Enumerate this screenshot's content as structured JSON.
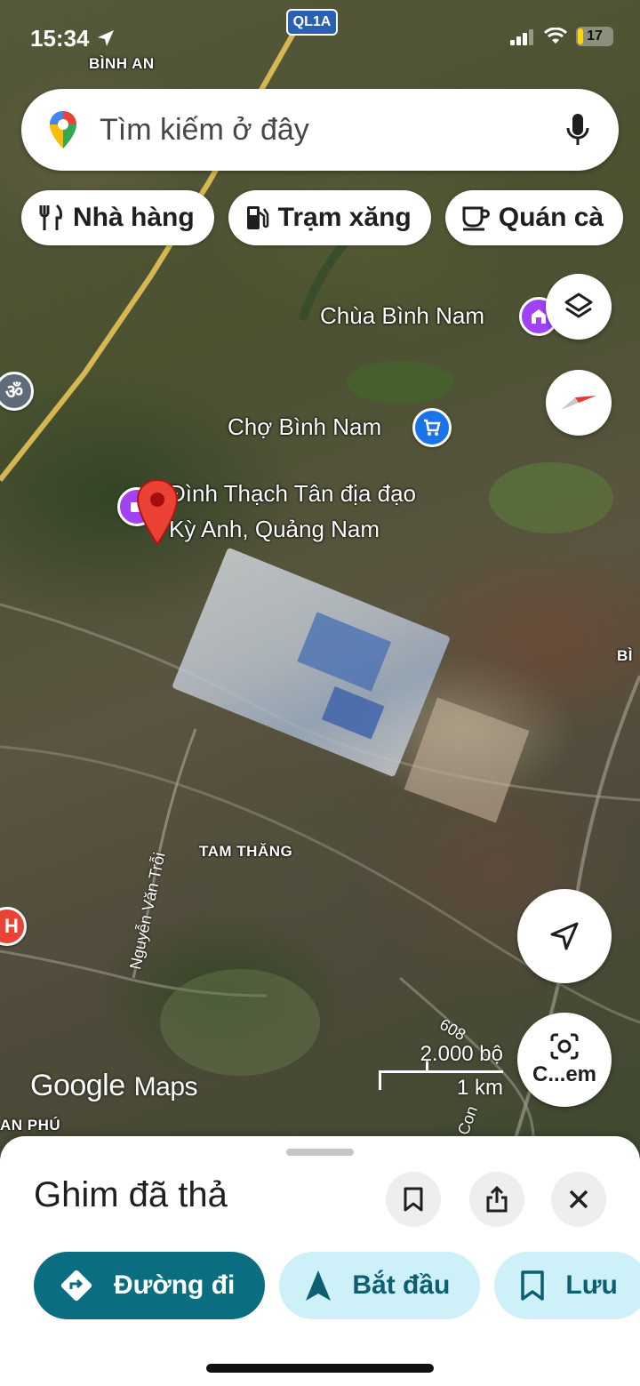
{
  "status_bar": {
    "time": "15:34",
    "battery": "17",
    "battery_level": 0.17
  },
  "highway_badge": "QL1A",
  "search": {
    "placeholder": "Tìm kiếm ở đây",
    "logo_icon": "google-maps-pin-icon",
    "mic_icon": "mic-icon"
  },
  "chips": [
    {
      "label": "Nhà hàng",
      "icon": "utensils-icon"
    },
    {
      "label": "Trạm xăng",
      "icon": "gas-station-icon"
    },
    {
      "label": "Quán cà",
      "icon": "coffee-icon"
    }
  ],
  "map": {
    "labels": {
      "binh_an": "BÌNH AN",
      "chua_binh_nam": "Chùa Bình Nam",
      "cho_binh_nam": "Chợ Bình Nam",
      "pin_line1": "Đình Thạch Tân địa đạo",
      "pin_line2": "Kỳ Anh, Quảng Nam",
      "tam_thang": "TAM THĂNG",
      "nguyen_van_troi": "Nguyễn Văn Trỗi",
      "an_phu": "AN PHÚ",
      "road_608": "608",
      "road_con": "Con",
      "bin_right": "BÌ"
    },
    "scale": {
      "top": "2.000 bộ",
      "bottom": "1 km"
    },
    "logo": {
      "google": "Google",
      "maps": "Maps"
    },
    "camera_button_label": "C...em"
  },
  "sheet": {
    "title": "Ghim đã thả",
    "actions": [
      {
        "label": "Đường đi",
        "icon": "directions-icon"
      },
      {
        "label": "Bắt đầu",
        "icon": "navigation-arrow-icon"
      },
      {
        "label": "Lưu",
        "icon": "bookmark-icon"
      }
    ]
  },
  "colors": {
    "primary": "#0b6e80",
    "secondary_bg": "#cdf0f9",
    "pin": "#ea4335",
    "poi_purple": "#a142f4",
    "poi_blue": "#1a73e8"
  }
}
